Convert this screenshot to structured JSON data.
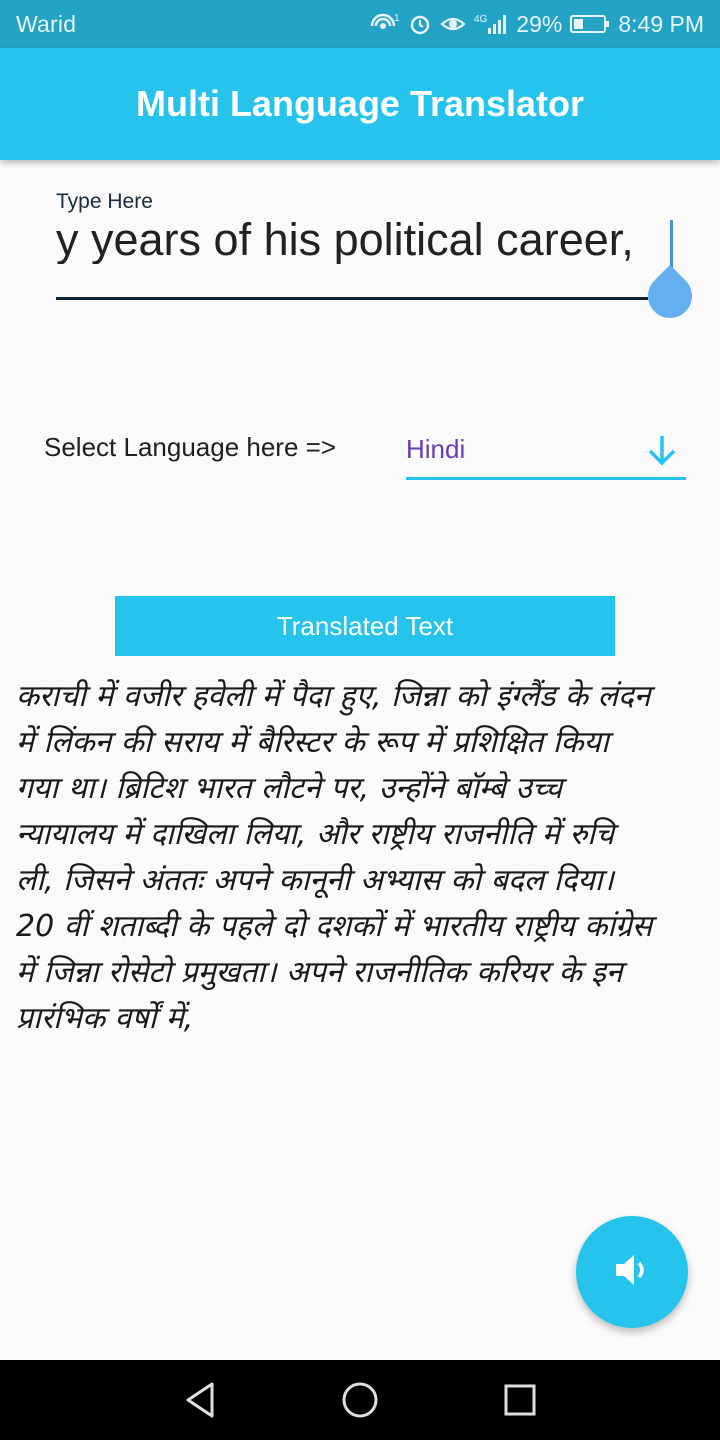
{
  "status_bar": {
    "carrier": "Warid",
    "network_label": "4G",
    "battery": "29%",
    "time": "8:49 PM",
    "icons": [
      "wifi-calling-icon",
      "alarm-icon",
      "eye-icon",
      "signal-icon",
      "battery-icon"
    ]
  },
  "app_bar": {
    "title": "Multi Language Translator"
  },
  "input": {
    "label": "Type Here",
    "value": "y years of his political career,"
  },
  "language": {
    "label": "Select Language here =>",
    "selected": "Hindi"
  },
  "translated_header": "Translated Text",
  "translation": {
    "lines": [
      "कराची में वजीर हवेली में पैदा हुए, जिन्ना को इंग्लैंड के लंदन",
      "में लिंकन की सराय में बैरिस्टर के रूप में प्रशिक्षित किया",
      "गया था। ब्रिटिश भारत लौटने पर, उन्होंने बॉम्बे उच्च",
      "न्यायालय में दाखिला लिया, और राष्ट्रीय राजनीति में रुचि",
      "ली, जिसने अंततः अपने कानूनी अभ्यास को बदल दिया।",
      "20 वीं शताब्दी के पहले दो दशकों में भारतीय राष्ट्रीय कांग्रेस",
      "में जिन्ना रोसेटो प्रमुखता। अपने राजनीतिक करियर के इन",
      "प्रारंभिक वर्षों में,"
    ]
  },
  "colors": {
    "status_bar": "#23a3c6",
    "app_bar": "#26c3ec",
    "accent": "#26c3ec",
    "dropdown_text": "#6a3bb8",
    "cursor": "#4a90e2",
    "background": "#fafafa"
  },
  "fab": {
    "icon": "speaker-icon"
  },
  "nav": {
    "icons": [
      "back-triangle-icon",
      "home-circle-icon",
      "recents-square-icon"
    ]
  }
}
